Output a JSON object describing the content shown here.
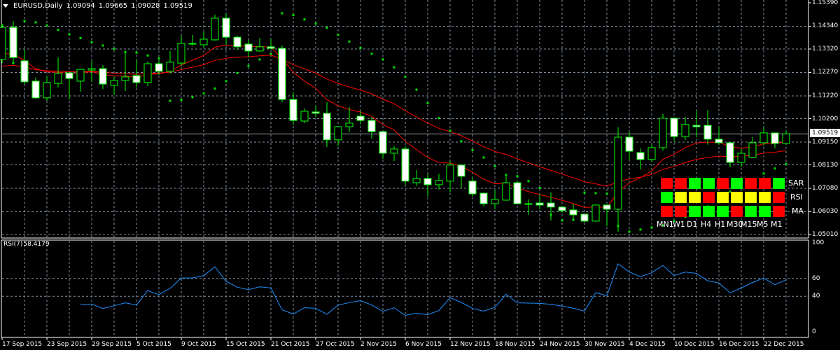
{
  "header": {
    "symbol": "EURUSD,Daily",
    "open": "1.09094",
    "high": "1.09665",
    "low": "1.09028",
    "close": "1.09519"
  },
  "rsi_header": {
    "label": "RSI(7)",
    "value": "58.4179"
  },
  "current_price": "1.09519",
  "colors": {
    "background": "#000000",
    "candle_outline": "#00ff00",
    "bear_body": "#ffffff",
    "ma": "#ff0000",
    "sar": "#00e000",
    "rsi": "#1e90ff",
    "grid": "#8090a0",
    "sig_red": "#ff0000",
    "sig_green": "#00ff00",
    "sig_yellow": "#ffff00"
  },
  "price_axis": [
    "1.15390",
    "1.14340",
    "1.13320",
    "1.12270",
    "1.11220",
    "1.10200",
    "1.09150",
    "1.08130",
    "1.07080",
    "1.06030",
    "1.05010"
  ],
  "rsi_axis": [
    "100",
    "60",
    "40",
    "0"
  ],
  "dates": [
    "17 Sep 2015",
    "23 Sep 2015",
    "29 Sep 2015",
    "5 Oct 2015",
    "9 Oct 2015",
    "15 Oct 2015",
    "21 Oct 2015",
    "27 Oct 2015",
    "2 Nov 2015",
    "6 Nov 2015",
    "12 Nov 2015",
    "18 Nov 2015",
    "24 Nov 2015",
    "30 Nov 2015",
    "4 Dec 2015",
    "10 Dec 2015",
    "16 Dec 2015",
    "22 Dec 2015"
  ],
  "signal_panel": {
    "timeframes": [
      "MN1",
      "W1",
      "D1",
      "H4",
      "H1",
      "M30",
      "M15",
      "M5",
      "M1"
    ],
    "rows": [
      {
        "label": "SAR",
        "states": [
          "red",
          "red",
          "green",
          "green",
          "red",
          "green",
          "red",
          "red",
          "green"
        ]
      },
      {
        "label": "RSI",
        "states": [
          "green",
          "yellow",
          "yellow",
          "red",
          "yellow",
          "yellow",
          "yellow",
          "yellow",
          "red"
        ]
      },
      {
        "label": "MA",
        "states": [
          "red",
          "red",
          "green",
          "green",
          "green",
          "red",
          "green",
          "green",
          "red"
        ]
      }
    ]
  },
  "chart_data": {
    "type": "candlestick",
    "title": "EURUSD,Daily",
    "ylim": [
      1.0501,
      1.1539
    ],
    "rsi_ylim": [
      0,
      100
    ],
    "ohlc": [
      [
        1.1285,
        1.1439,
        1.1269,
        1.1429
      ],
      [
        1.1429,
        1.1457,
        1.1263,
        1.1294
      ],
      [
        1.1279,
        1.1329,
        1.1175,
        1.1185
      ],
      [
        1.1188,
        1.1204,
        1.111,
        1.1113
      ],
      [
        1.1113,
        1.121,
        1.11,
        1.1182
      ],
      [
        1.1178,
        1.1294,
        1.116,
        1.1222
      ],
      [
        1.1225,
        1.1228,
        1.1106,
        1.12
      ],
      [
        1.1188,
        1.1244,
        1.1141,
        1.1241
      ],
      [
        1.1238,
        1.1279,
        1.1185,
        1.1244
      ],
      [
        1.1244,
        1.126,
        1.1153,
        1.1175
      ],
      [
        1.1169,
        1.1207,
        1.1125,
        1.1191
      ],
      [
        1.1191,
        1.1316,
        1.1144,
        1.1207
      ],
      [
        1.1213,
        1.1285,
        1.116,
        1.1182
      ],
      [
        1.1182,
        1.1276,
        1.1166,
        1.1266
      ],
      [
        1.1266,
        1.1282,
        1.1216,
        1.1232
      ],
      [
        1.1232,
        1.1323,
        1.1222,
        1.1273
      ],
      [
        1.1269,
        1.1392,
        1.1254,
        1.1357
      ],
      [
        1.1354,
        1.1395,
        1.1348,
        1.1357
      ],
      [
        1.1351,
        1.141,
        1.1338,
        1.1376
      ],
      [
        1.1373,
        1.1486,
        1.137,
        1.147
      ],
      [
        1.147,
        1.1492,
        1.1351,
        1.1385
      ],
      [
        1.1385,
        1.1392,
        1.1329,
        1.1342
      ],
      [
        1.1354,
        1.1373,
        1.1294,
        1.1323
      ],
      [
        1.1323,
        1.1382,
        1.132,
        1.1342
      ],
      [
        1.1342,
        1.1376,
        1.1332,
        1.1335
      ],
      [
        1.1335,
        1.1348,
        1.1094,
        1.1106
      ],
      [
        1.1106,
        1.1138,
        1.0994,
        1.1012
      ],
      [
        1.1009,
        1.1066,
        1.1,
        1.1053
      ],
      [
        1.105,
        1.1078,
        1.1028,
        1.1044
      ],
      [
        1.1044,
        1.1094,
        1.0893,
        1.0925
      ],
      [
        1.0925,
        1.0984,
        1.0896,
        1.0984
      ],
      [
        1.0984,
        1.1072,
        1.0962,
        1.1
      ],
      [
        1.1031,
        1.1053,
        1.0994,
        1.1012
      ],
      [
        1.1012,
        1.1028,
        1.0931,
        1.0962
      ],
      [
        1.0962,
        1.0965,
        1.084,
        1.0865
      ],
      [
        1.0865,
        1.0896,
        1.083,
        1.0884
      ],
      [
        1.0884,
        1.0896,
        1.0724,
        1.074
      ],
      [
        1.0733,
        1.079,
        1.0718,
        1.0752
      ],
      [
        1.0752,
        1.0771,
        1.0671,
        1.0724
      ],
      [
        1.0724,
        1.0774,
        1.0702,
        1.0743
      ],
      [
        1.074,
        1.083,
        1.0689,
        1.0812
      ],
      [
        1.0812,
        1.0815,
        1.0711,
        1.0762
      ],
      [
        1.074,
        1.0758,
        1.0671,
        1.0683
      ],
      [
        1.0686,
        1.0689,
        1.0627,
        1.0639
      ],
      [
        1.0639,
        1.0699,
        1.0614,
        1.0658
      ],
      [
        1.0655,
        1.0762,
        1.0652,
        1.0733
      ],
      [
        1.0733,
        1.074,
        1.0636,
        1.0639
      ],
      [
        1.0639,
        1.0658,
        1.0589,
        1.0636
      ],
      [
        1.0642,
        1.068,
        1.0614,
        1.0633
      ],
      [
        1.0642,
        1.0689,
        1.0564,
        1.0624
      ],
      [
        1.0624,
        1.0627,
        1.0599,
        1.0608
      ],
      [
        1.0611,
        1.0639,
        1.0567,
        1.0589
      ],
      [
        1.0592,
        1.0595,
        1.0555,
        1.0561
      ],
      [
        1.0561,
        1.0633,
        1.0558,
        1.0633
      ],
      [
        1.0633,
        1.0636,
        1.0539,
        1.0614
      ],
      [
        1.0614,
        1.0981,
        1.0514,
        1.0937
      ],
      [
        1.0937,
        1.0962,
        1.0837,
        1.0874
      ],
      [
        1.0868,
        1.0887,
        1.0793,
        1.0837
      ],
      [
        1.0837,
        1.0903,
        1.0824,
        1.089
      ],
      [
        1.089,
        1.1041,
        1.0877,
        1.1022
      ],
      [
        1.1022,
        1.1025,
        1.0918,
        1.094
      ],
      [
        1.094,
        1.1028,
        1.0925,
        1.0994
      ],
      [
        1.099,
        1.1056,
        1.0937,
        1.0984
      ],
      [
        1.099,
        1.1059,
        1.0903,
        1.0928
      ],
      [
        1.0928,
        1.0984,
        1.0903,
        1.0912
      ],
      [
        1.0912,
        1.0915,
        1.0802,
        1.0824
      ],
      [
        1.0824,
        1.0884,
        1.0805,
        1.0865
      ],
      [
        1.0846,
        1.0937,
        1.0843,
        1.0912
      ],
      [
        1.0912,
        1.0981,
        1.0899,
        1.0956
      ],
      [
        1.0956,
        1.0956,
        1.0887,
        1.0909
      ],
      [
        1.09094,
        1.09665,
        1.09028,
        1.09519
      ]
    ]
  }
}
